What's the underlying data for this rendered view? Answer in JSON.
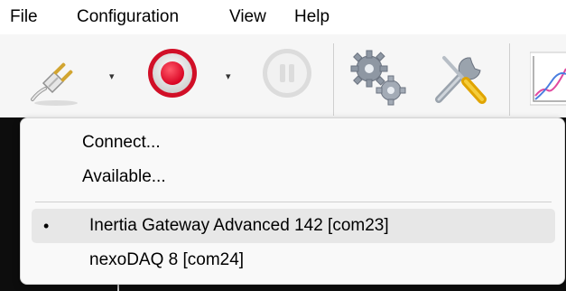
{
  "menubar": {
    "items": [
      {
        "label": "File"
      },
      {
        "label": "Configuration"
      },
      {
        "label": "View"
      },
      {
        "label": "Help"
      }
    ]
  },
  "toolbar": {
    "icons": [
      "plug-connect-icon",
      "record-icon",
      "pause-icon",
      "gears-icon",
      "tools-icon",
      "chart-icon"
    ],
    "dropdown_arrow": "▾"
  },
  "popup": {
    "items": [
      {
        "label": "Connect..."
      },
      {
        "label": "Available..."
      }
    ],
    "devices": [
      {
        "label": "Inertia Gateway Advanced 142 [com23]",
        "selected": true,
        "bullet": "•"
      },
      {
        "label": "nexoDAQ 8 [com24]",
        "selected": false
      }
    ]
  },
  "colors": {
    "record_red": "#e0102a",
    "pause_disabled": "#d8d8d8",
    "menu_highlight": "#e7e7e7",
    "workspace": "#0d0d0d"
  }
}
